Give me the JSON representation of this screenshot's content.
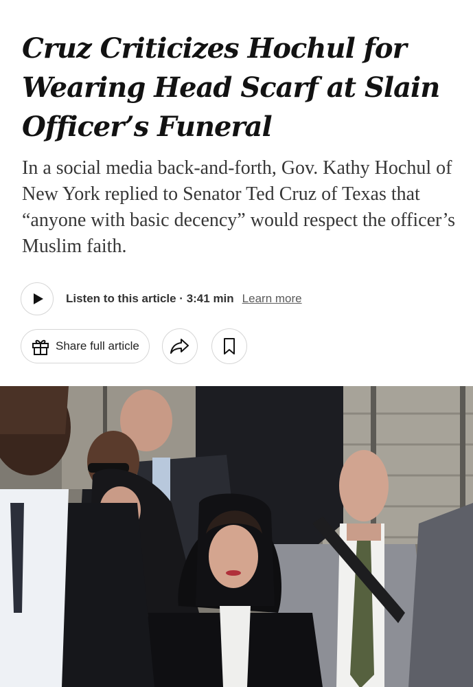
{
  "article": {
    "headline": "Cruz Criticizes Hochul for Wearing Head Scarf at Slain Officer’s Funeral",
    "summary": "In a social media back-and-forth, Gov. Kathy Hochul of New York replied to Senator Ted Cruz of Texas that “anyone with basic decency” would respect the officer’s Muslim faith."
  },
  "audio": {
    "play_icon": "play-icon",
    "listen_label": "Listen to this article · 3:41 min",
    "learn_more": "Learn more"
  },
  "actions": {
    "share_full_label": "Share full article",
    "gift_icon": "gift-icon",
    "share_icon": "share-forward-icon",
    "save_icon": "bookmark-icon"
  },
  "photo": {
    "subject": "Gov. Kathy Hochul in black head scarf walking with security detail"
  },
  "colors": {
    "text": "#121212",
    "summary_text": "#363636",
    "border": "#d5d5d5"
  }
}
